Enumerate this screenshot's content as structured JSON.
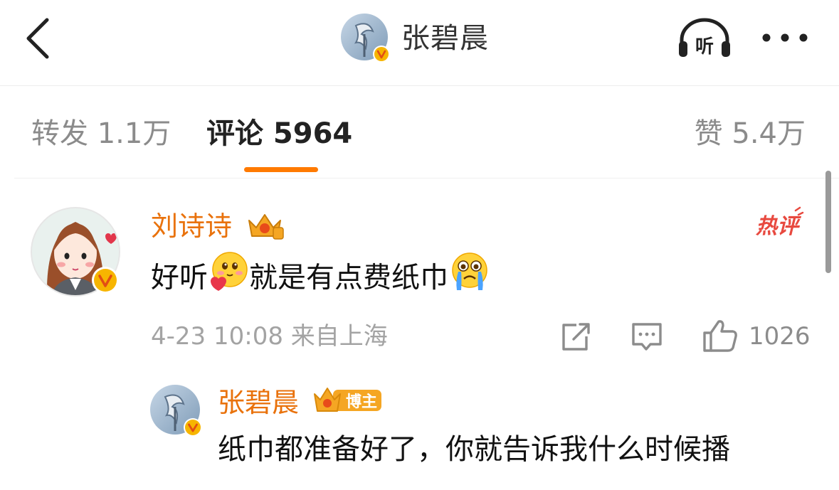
{
  "header": {
    "title": "张碧晨",
    "listen_label": "听"
  },
  "tabs": {
    "repost": "转发 1.1万",
    "comments": "评论 5964",
    "likes": "赞 5.4万"
  },
  "comment": {
    "author": "刘诗诗",
    "text_part1": "好听",
    "text_part2": "就是有点费纸巾",
    "hot_tag": "热评",
    "meta": "4-23 10:08 来自上海",
    "like_count": "1026",
    "icons": [
      "crown-badge-icon",
      "blush-heart-emoji",
      "crying-emoji",
      "share-icon",
      "reply-icon",
      "thumbs-up-icon"
    ]
  },
  "reply": {
    "author": "张碧晨",
    "badge": "博主",
    "text": "纸巾都准备好了，你就告诉我什么时候播"
  },
  "colors": {
    "accent": "#ff7a00",
    "username": "#e9720c",
    "hot_tag": "#e8493f",
    "verified": "#f7b500"
  }
}
